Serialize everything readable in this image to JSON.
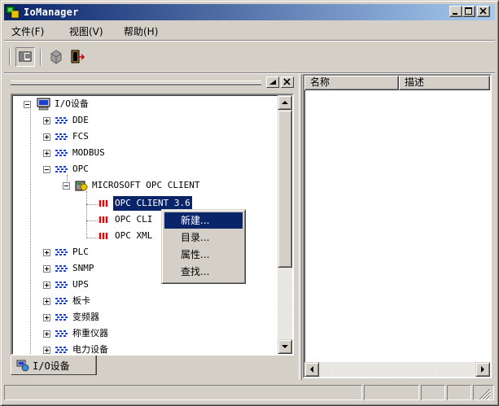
{
  "window": {
    "title": "IoManager",
    "controls": {
      "minimize": "minimize",
      "maximize": "maximize",
      "close": "close"
    }
  },
  "menu": [
    {
      "label": "文件(F)"
    },
    {
      "label": "视图(V)"
    },
    {
      "label": "帮助(H)"
    }
  ],
  "toolbar": {
    "buttons": [
      "view-toggle-icon",
      "properties-icon",
      "exit-icon"
    ]
  },
  "tree": {
    "root": "I/O设备",
    "items": [
      {
        "label": "DDE"
      },
      {
        "label": "FCS"
      },
      {
        "label": "MODBUS"
      },
      {
        "label": "OPC"
      },
      {
        "label": "MICROSOFT OPC CLIENT"
      },
      {
        "label": "OPC CLIENT 3.6"
      },
      {
        "label": "OPC CLI"
      },
      {
        "label": "OPC XML"
      },
      {
        "label": "PLC"
      },
      {
        "label": "SNMP"
      },
      {
        "label": "UPS"
      },
      {
        "label": "板卡"
      },
      {
        "label": "变频器"
      },
      {
        "label": "称重仪器"
      },
      {
        "label": "电力设备"
      }
    ]
  },
  "tab": {
    "label": "I/O设备"
  },
  "list": {
    "columns": [
      {
        "label": "名称"
      },
      {
        "label": "描述"
      }
    ]
  },
  "context_menu": {
    "items": [
      {
        "label": "新建..."
      },
      {
        "label": "目录..."
      },
      {
        "label": "属性..."
      },
      {
        "label": "查找..."
      }
    ]
  },
  "colors": {
    "selection": "#0a246a",
    "title_start": "#0a246a",
    "title_end": "#a6caf0",
    "face": "#d4d0c8",
    "device_icon": "#1a3fcf",
    "tag_icon": "#d01010"
  }
}
